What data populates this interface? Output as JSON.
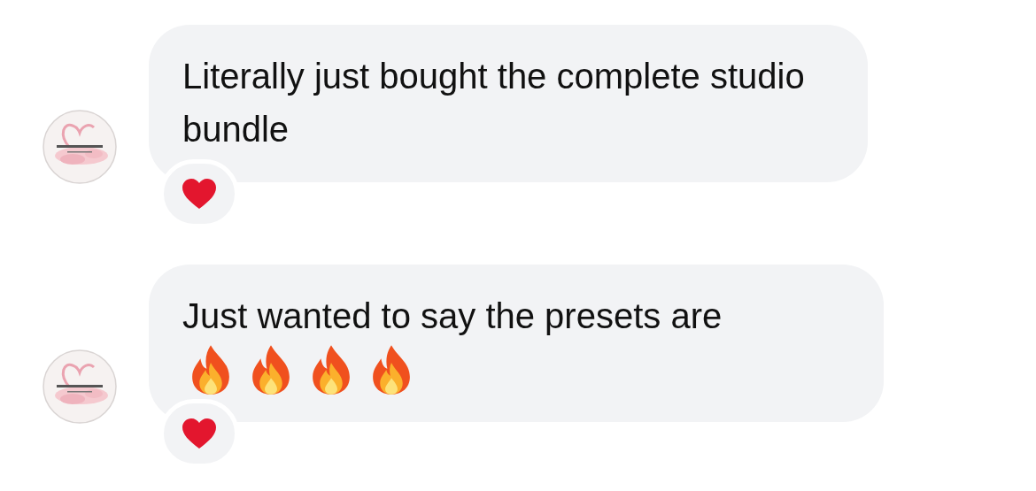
{
  "messages": [
    {
      "text": "Literally just bought the complete studio bundle",
      "reaction": {
        "kind": "heart"
      }
    },
    {
      "text": "Just wanted to say the presets are",
      "emojis": [
        {
          "kind": "fire"
        },
        {
          "kind": "fire"
        },
        {
          "kind": "fire"
        },
        {
          "kind": "fire"
        }
      ],
      "reaction": {
        "kind": "heart"
      }
    }
  ]
}
